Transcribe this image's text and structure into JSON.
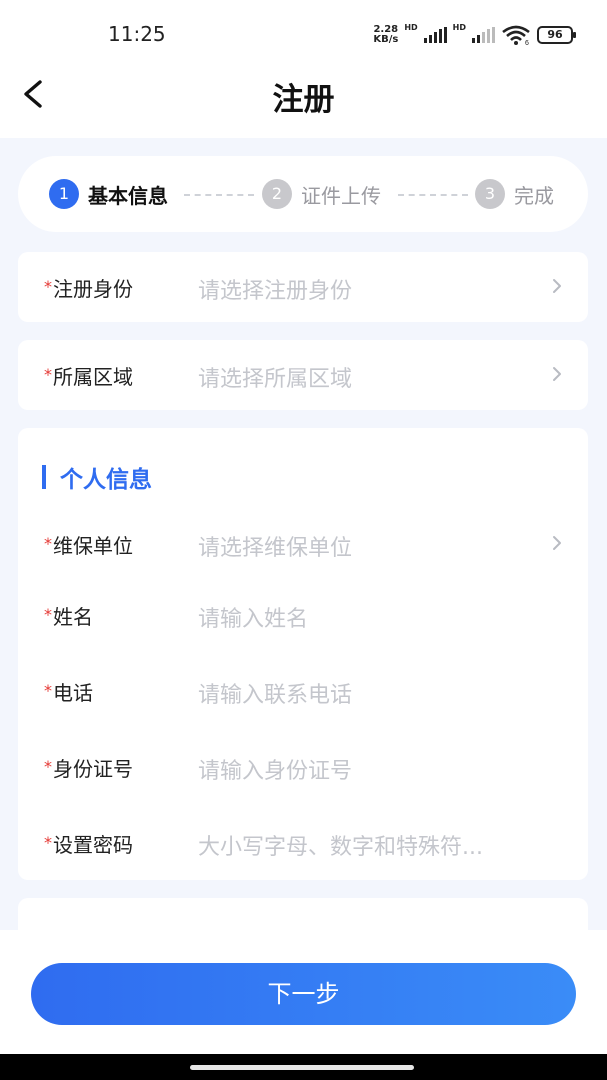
{
  "status": {
    "time": "11:25",
    "net_speed": "2.28",
    "net_unit": "KB/s",
    "hd1": "HD",
    "hd2": "HD",
    "wifi_sub": "6",
    "battery": "96"
  },
  "nav": {
    "title": "注册"
  },
  "steps": [
    {
      "num": "1",
      "label": "基本信息"
    },
    {
      "num": "2",
      "label": "证件上传"
    },
    {
      "num": "3",
      "label": "完成"
    }
  ],
  "fields": {
    "role": {
      "required": "*",
      "label": "注册身份",
      "placeholder": "请选择注册身份"
    },
    "region": {
      "required": "*",
      "label": "所属区域",
      "placeholder": "请选择所属区域"
    }
  },
  "personal": {
    "title": "个人信息",
    "unit": {
      "required": "*",
      "label": "维保单位",
      "placeholder": "请选择维保单位"
    },
    "name": {
      "required": "*",
      "label": "姓名",
      "placeholder": "请输入姓名"
    },
    "phone": {
      "required": "*",
      "label": "电话",
      "placeholder": "请输入联系电话"
    },
    "id_no": {
      "required": "*",
      "label": "身份证号",
      "placeholder": "请输入身份证号"
    },
    "password": {
      "required": "*",
      "label": "设置密码",
      "placeholder": "大小写字母、数字和特殊符..."
    }
  },
  "footer": {
    "next_label": "下一步"
  },
  "colors": {
    "accent": "#2f6cf0",
    "required": "#e53935",
    "placeholder": "#c4c6cc",
    "background": "#f3f6fd"
  }
}
